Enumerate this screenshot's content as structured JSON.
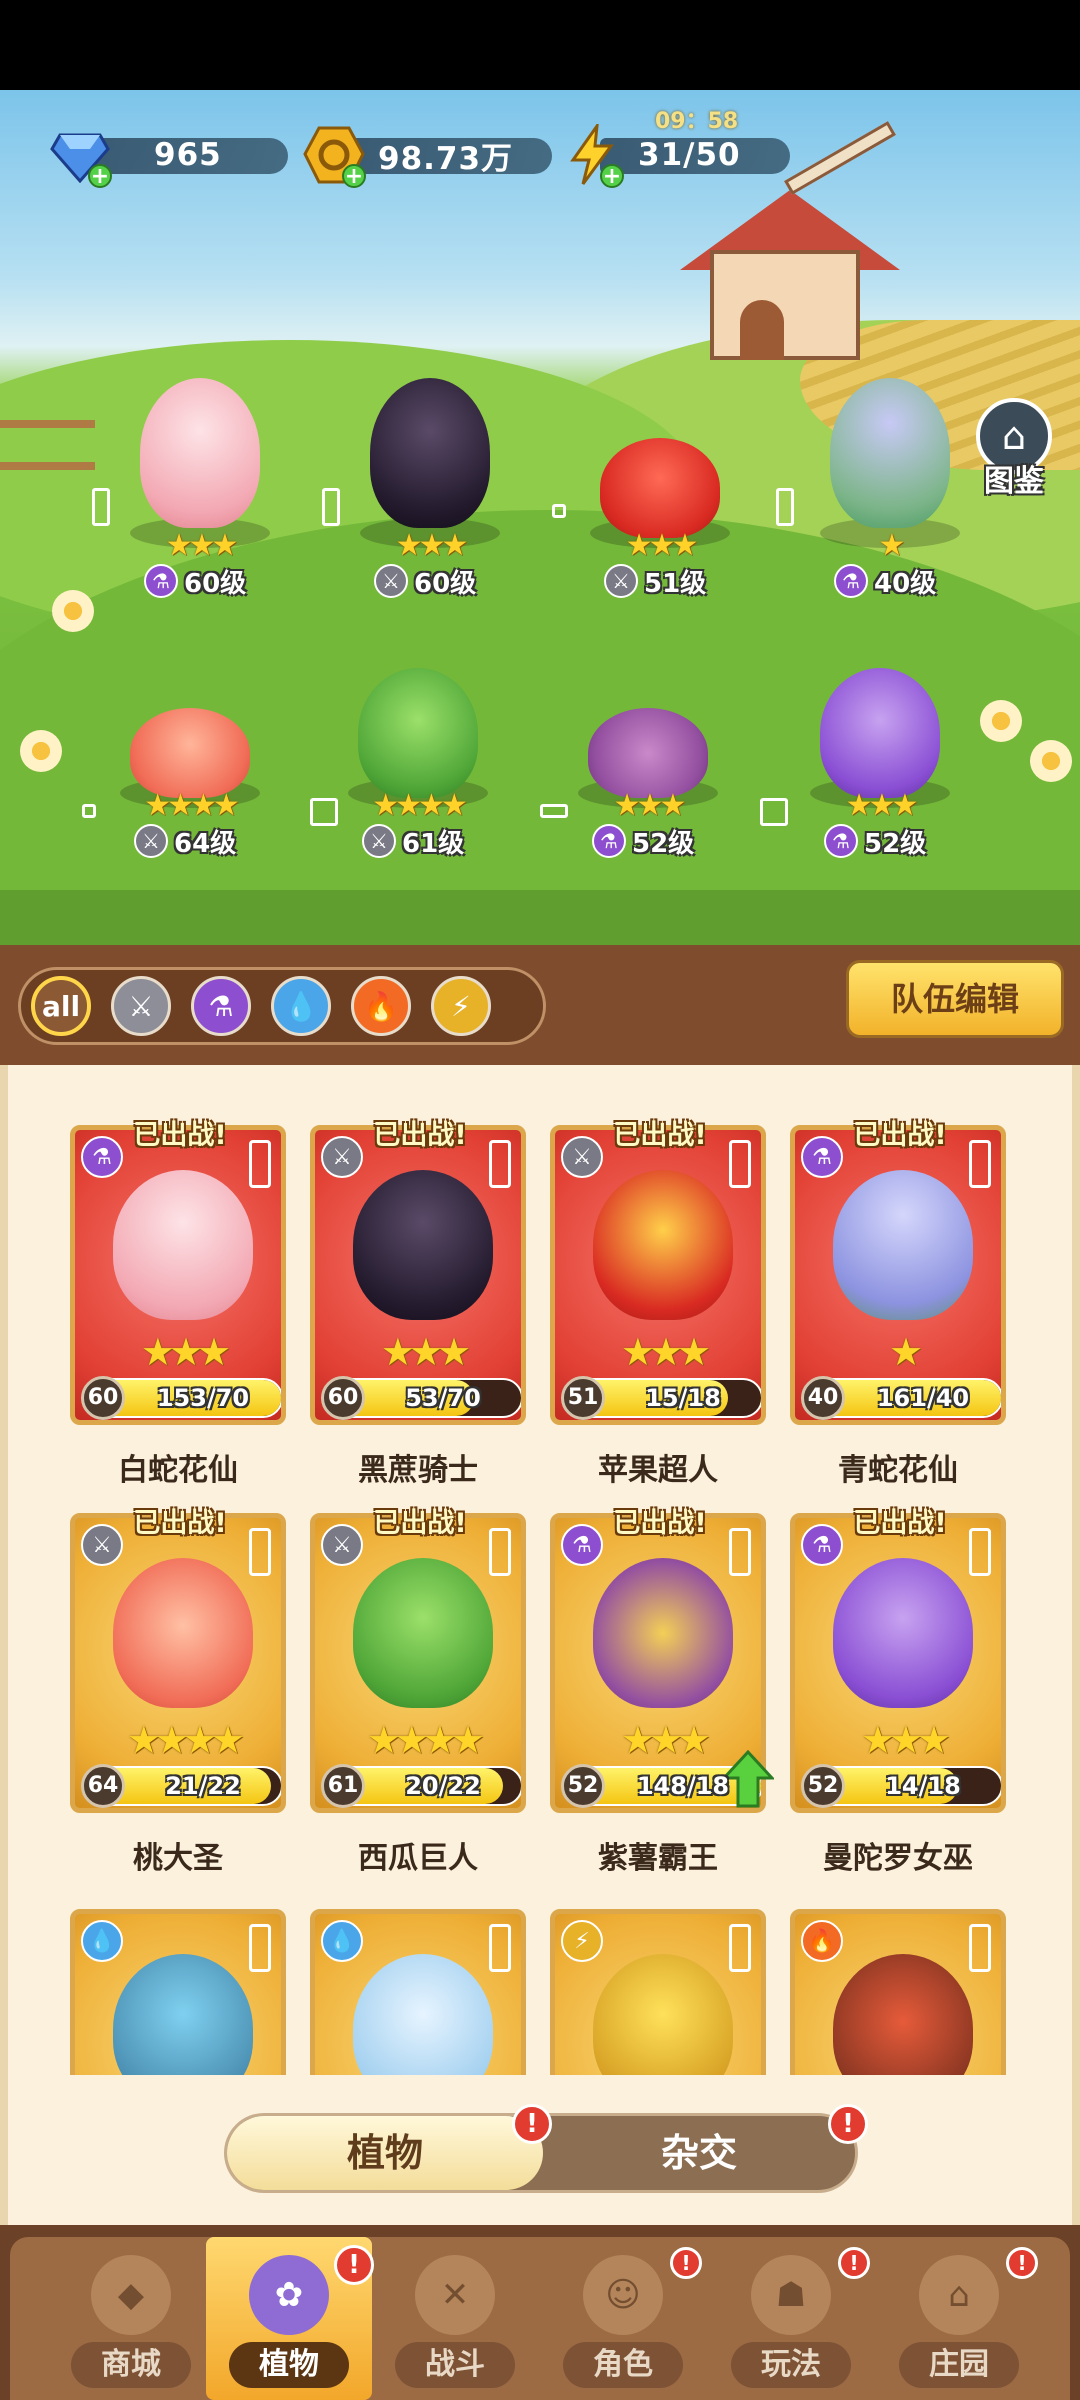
{
  "resources": {
    "gems": "965",
    "coins": "98.73万",
    "energy": "31/50",
    "energy_timer": "09：58"
  },
  "codex_label": "图鉴",
  "team_heroes": [
    {
      "stars": "★★★",
      "level": "60级",
      "type": "potion"
    },
    {
      "stars": "★★★",
      "level": "60级",
      "type": "sword"
    },
    {
      "stars": "★★★",
      "level": "51级",
      "type": "sword"
    },
    {
      "stars": "★",
      "level": "40级",
      "type": "potion"
    },
    {
      "stars": "★★★★",
      "level": "64级",
      "type": "sword"
    },
    {
      "stars": "★★★★",
      "level": "61级",
      "type": "sword"
    },
    {
      "stars": "★★★",
      "level": "52级",
      "type": "potion"
    },
    {
      "stars": "★★★",
      "level": "52级",
      "type": "potion"
    }
  ],
  "filters": [
    {
      "label": "all"
    },
    {
      "icon": "sword-icon"
    },
    {
      "icon": "potion-icon"
    },
    {
      "icon": "water-icon"
    },
    {
      "icon": "fire-icon"
    },
    {
      "icon": "lightning-icon"
    }
  ],
  "team_edit_label": "队伍编辑",
  "deployed_label": "已出战!",
  "cards": [
    {
      "name": "白蛇花仙",
      "level": "60",
      "count": "153/70",
      "progress": 1.0,
      "stars": "★★★",
      "frame": "red"
    },
    {
      "name": "黑蔗骑士",
      "level": "60",
      "count": "53/70",
      "progress": 0.76,
      "stars": "★★★",
      "frame": "red"
    },
    {
      "name": "苹果超人",
      "level": "51",
      "count": "15/18",
      "progress": 0.83,
      "stars": "★★★",
      "frame": "red"
    },
    {
      "name": "青蛇花仙",
      "level": "40",
      "count": "161/40",
      "progress": 1.0,
      "stars": "★",
      "frame": "red"
    },
    {
      "name": "桃大圣",
      "level": "64",
      "count": "21/22",
      "progress": 0.95,
      "stars": "★★★★",
      "frame": "gold"
    },
    {
      "name": "西瓜巨人",
      "level": "61",
      "count": "20/22",
      "progress": 0.91,
      "stars": "★★★★",
      "frame": "gold"
    },
    {
      "name": "紫薯霸王",
      "level": "52",
      "count": "148/18",
      "progress": 1.0,
      "stars": "★★★",
      "frame": "gold"
    },
    {
      "name": "曼陀罗女巫",
      "level": "52",
      "count": "14/18",
      "progress": 0.78,
      "stars": "★★★",
      "frame": "gold"
    }
  ],
  "toggle": {
    "left": "植物",
    "right": "杂交",
    "alert": "!"
  },
  "nav": [
    {
      "label": "商城"
    },
    {
      "label": "植物"
    },
    {
      "label": "战斗"
    },
    {
      "label": "角色"
    },
    {
      "label": "玩法"
    },
    {
      "label": "庄园"
    }
  ]
}
